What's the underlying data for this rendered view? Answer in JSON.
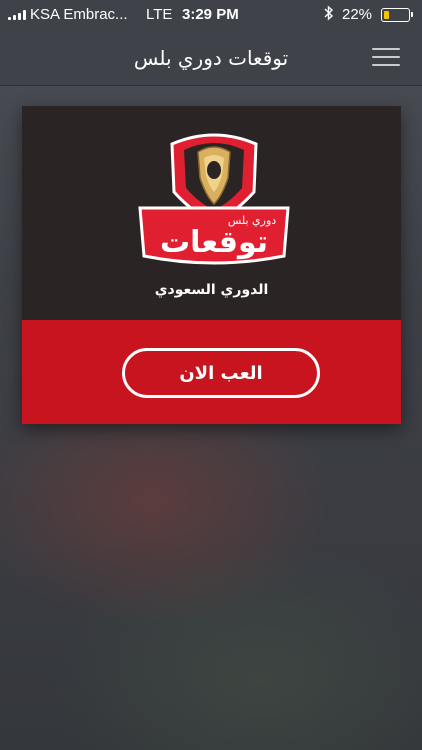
{
  "status_bar": {
    "carrier": "KSA Embrac...",
    "network": "LTE",
    "time": "3:29 PM",
    "battery_percent": "22%",
    "battery_level": 0.22,
    "bluetooth_icon": "bluetooth-icon",
    "battery_fill_color": "#f5c400"
  },
  "nav": {
    "title": "توقعات دوري بلس",
    "menu_icon": "hamburger-menu-icon"
  },
  "card": {
    "logo": {
      "badge_line": "دوري بلس",
      "main_text": "توقعات",
      "subtitle": "الدوري السعودي"
    },
    "play_button_label": "العب الان",
    "top_color": "#2b2424",
    "bottom_color": "#c8141f"
  }
}
